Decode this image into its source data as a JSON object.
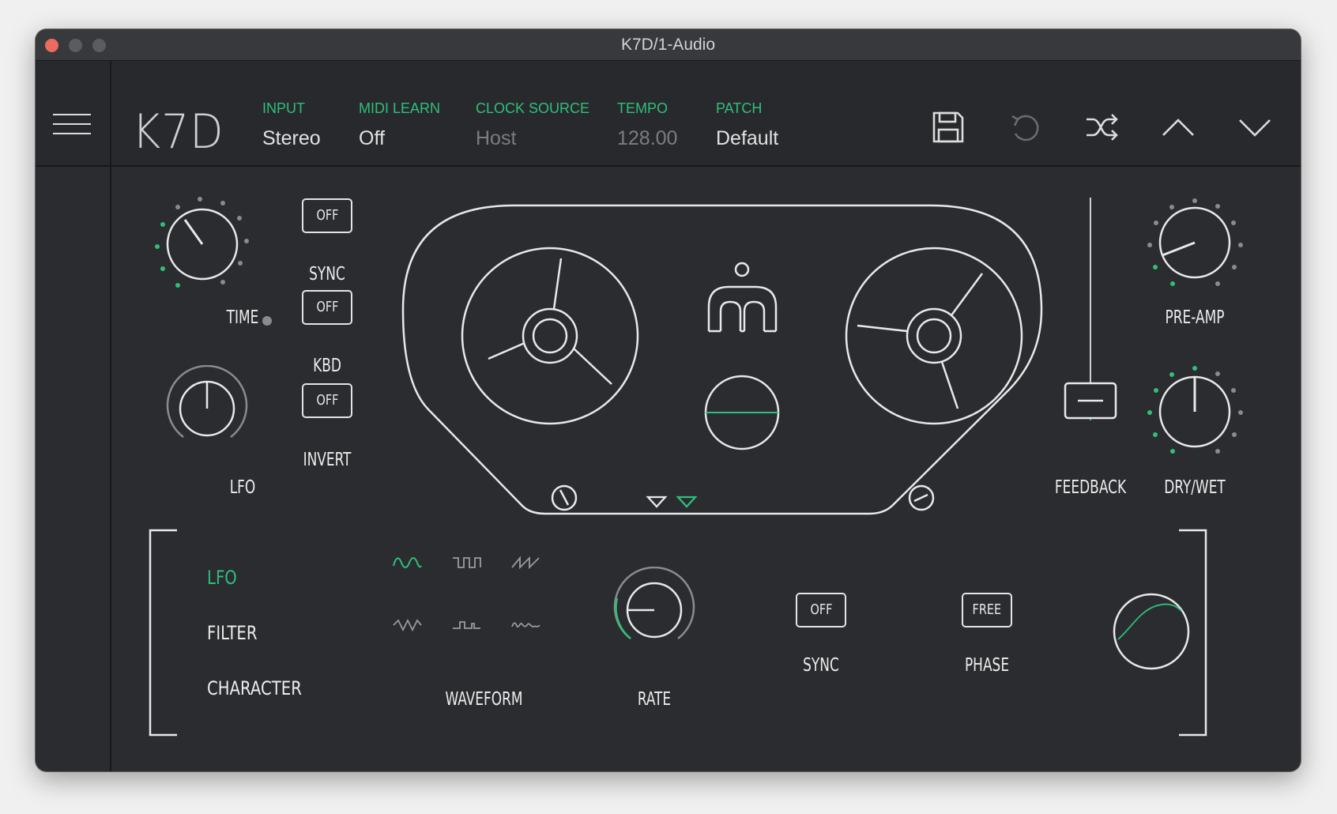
{
  "window": {
    "title": "K7D/1-Audio"
  },
  "header": {
    "logo": "K7D",
    "fields": {
      "input": {
        "label": "INPUT",
        "value": "Stereo"
      },
      "midi_learn": {
        "label": "MIDI LEARN",
        "value": "Off"
      },
      "clock_source": {
        "label": "CLOCK SOURCE",
        "value": "Host"
      },
      "tempo": {
        "label": "TEMPO",
        "value": "128.00"
      },
      "patch": {
        "label": "PATCH",
        "value": "Default"
      }
    },
    "icons": [
      "save-icon",
      "undo-icon",
      "shuffle-icon",
      "chevron-up-icon",
      "chevron-down-icon"
    ]
  },
  "delay": {
    "time_label": "TIME",
    "lfo_label": "LFO",
    "sync": {
      "value": "OFF",
      "label": "SYNC"
    },
    "kbd": {
      "value": "OFF",
      "label": "KBD"
    },
    "invert": {
      "value": "OFF",
      "label": "INVERT"
    }
  },
  "right_controls": {
    "preamp_label": "PRE-AMP",
    "feedback_label": "FEEDBACK",
    "drywet_label": "DRY/WET"
  },
  "modulation": {
    "tabs": [
      "LFO",
      "FILTER",
      "CHARACTER"
    ],
    "active_tab": "LFO",
    "waveform_label": "WAVEFORM",
    "waveforms": [
      "sine-wave-icon",
      "square-wave-icon",
      "saw-wave-icon",
      "triangle-wave-icon",
      "pulse-wave-icon",
      "random-wave-icon"
    ],
    "rate_label": "RATE",
    "sync": {
      "value": "OFF",
      "label": "SYNC"
    },
    "phase": {
      "value": "FREE",
      "label": "PHASE"
    }
  },
  "colors": {
    "accent": "#2fbf7a",
    "background": "#2b2c30",
    "header": "#28292d",
    "close": "#ed6a5e"
  }
}
